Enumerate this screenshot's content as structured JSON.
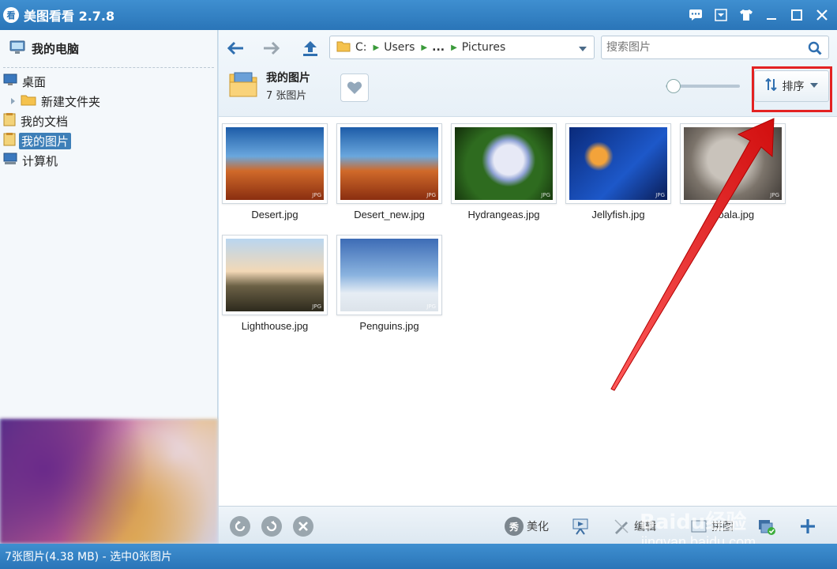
{
  "window": {
    "title": "美图看看 2.7.8",
    "logo_text": "看"
  },
  "sidebar": {
    "header": "我的电脑",
    "items": [
      {
        "label": "桌面"
      },
      {
        "label": "新建文件夹"
      },
      {
        "label": "我的文档"
      },
      {
        "label": "我的图片"
      },
      {
        "label": "计算机"
      }
    ]
  },
  "toolbar": {
    "path": [
      "C:",
      "Users",
      "...",
      "Pictures"
    ],
    "search_placeholder": "搜索图片",
    "folder_name": "我的图片",
    "folder_count": "7 张图片",
    "sort_label": "排序"
  },
  "thumbnails": [
    {
      "caption": "Desert.jpg",
      "badge": "JPG"
    },
    {
      "caption": "Desert_new.jpg",
      "badge": "JPG"
    },
    {
      "caption": "Hydrangeas.jpg",
      "badge": "JPG"
    },
    {
      "caption": "Jellyfish.jpg",
      "badge": "JPG"
    },
    {
      "caption": "Koala.jpg",
      "badge": "JPG"
    },
    {
      "caption": "Lighthouse.jpg",
      "badge": "JPG"
    },
    {
      "caption": "Penguins.jpg",
      "badge": "JPG"
    }
  ],
  "actionbar": {
    "beautify_icon": "秀",
    "beautify": "美化",
    "edit": "编辑",
    "collage": "拼图"
  },
  "watermark": {
    "brand": "Baidu经验",
    "url": "jingyan.baidu.com"
  },
  "status": {
    "text": "7张图片(4.38 MB) - 选中0张图片"
  },
  "colors": {
    "accent": "#2a75b8",
    "highlight": "#e32222"
  }
}
